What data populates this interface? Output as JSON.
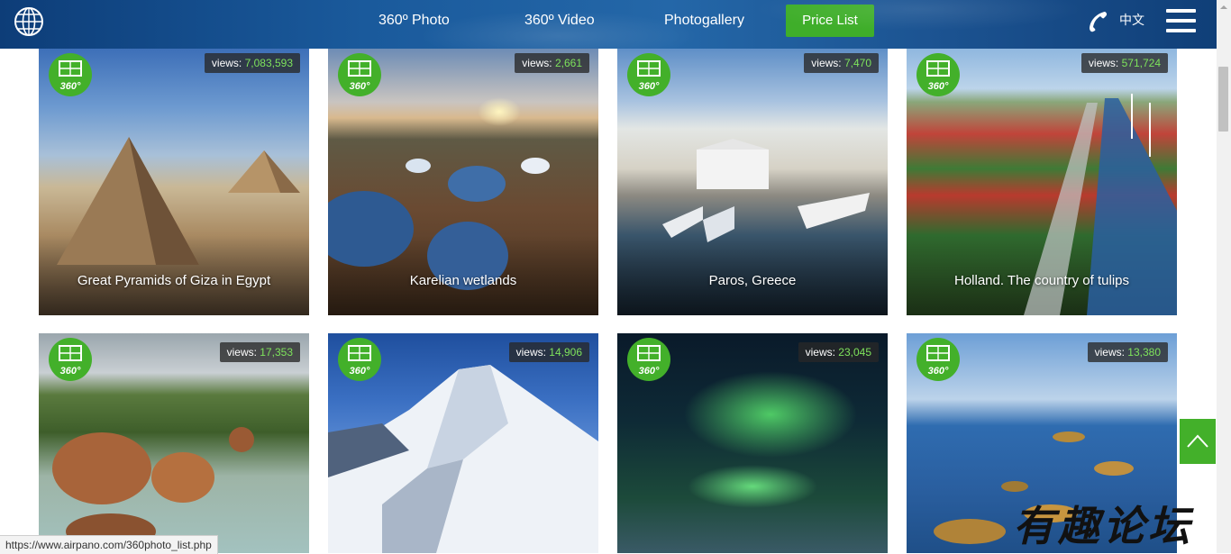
{
  "header": {
    "nav": [
      "360º Photo",
      "360º Video",
      "Photogallery"
    ],
    "price_button": "Price List",
    "language": "中文"
  },
  "cards_row1": [
    {
      "views_label": "views:",
      "views": "7,083,593",
      "title": "Great Pyramids of Giza in Egypt"
    },
    {
      "views_label": "views:",
      "views": "2,661",
      "title": "Karelian wetlands"
    },
    {
      "views_label": "views:",
      "views": "7,470",
      "title": "Paros, Greece"
    },
    {
      "views_label": "views:",
      "views": "571,724",
      "title": "Holland. The country of tulips"
    }
  ],
  "cards_row2": [
    {
      "views_label": "views:",
      "views": "17,353"
    },
    {
      "views_label": "views:",
      "views": "14,906"
    },
    {
      "views_label": "views:",
      "views": "23,045"
    },
    {
      "views_label": "views:",
      "views": "13,380"
    }
  ],
  "badge_text": "360°",
  "status_bar_url": "https://www.airpano.com/360photo_list.php",
  "watermark": "有趣论坛",
  "colors": {
    "accent": "#43b02a",
    "views_number": "#7ee35c",
    "header": "#1a5a9c"
  }
}
